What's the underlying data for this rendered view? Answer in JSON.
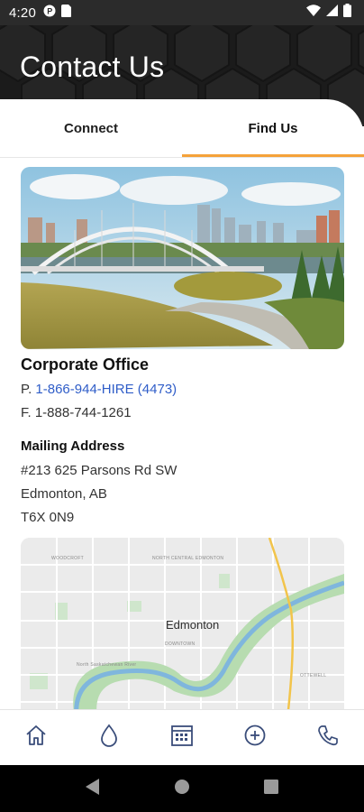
{
  "status_bar": {
    "time": "4:20"
  },
  "header": {
    "title": "Contact Us"
  },
  "tabs": [
    {
      "label": "Connect",
      "active": false
    },
    {
      "label": "Find Us",
      "active": true
    }
  ],
  "office": {
    "title": "Corporate Office",
    "phone_prefix": "P. ",
    "phone": "1-866-944-HIRE (4473)",
    "fax": "F. 1-888-744-1261"
  },
  "mailing": {
    "title": "Mailing Address",
    "lines": [
      "#213 625 Parsons Rd SW",
      "Edmonton, AB",
      "T6X 0N9"
    ]
  },
  "map": {
    "city": "Edmonton",
    "labels": [
      "WOODCROFT",
      "NORTH CENTRAL EDMONTON",
      "DOWNTOWN",
      "OTTEWELL",
      "North Saskatchewan River"
    ]
  },
  "bottom_nav": [
    {
      "icon": "home-icon"
    },
    {
      "icon": "water-drop-icon"
    },
    {
      "icon": "calendar-icon"
    },
    {
      "icon": "add-circle-icon"
    },
    {
      "icon": "phone-icon"
    }
  ],
  "colors": {
    "accent": "#f5a23a",
    "link": "#2f5dc8",
    "nav_icon": "#3a4d7a",
    "header_bg": "#1b1b1b"
  }
}
